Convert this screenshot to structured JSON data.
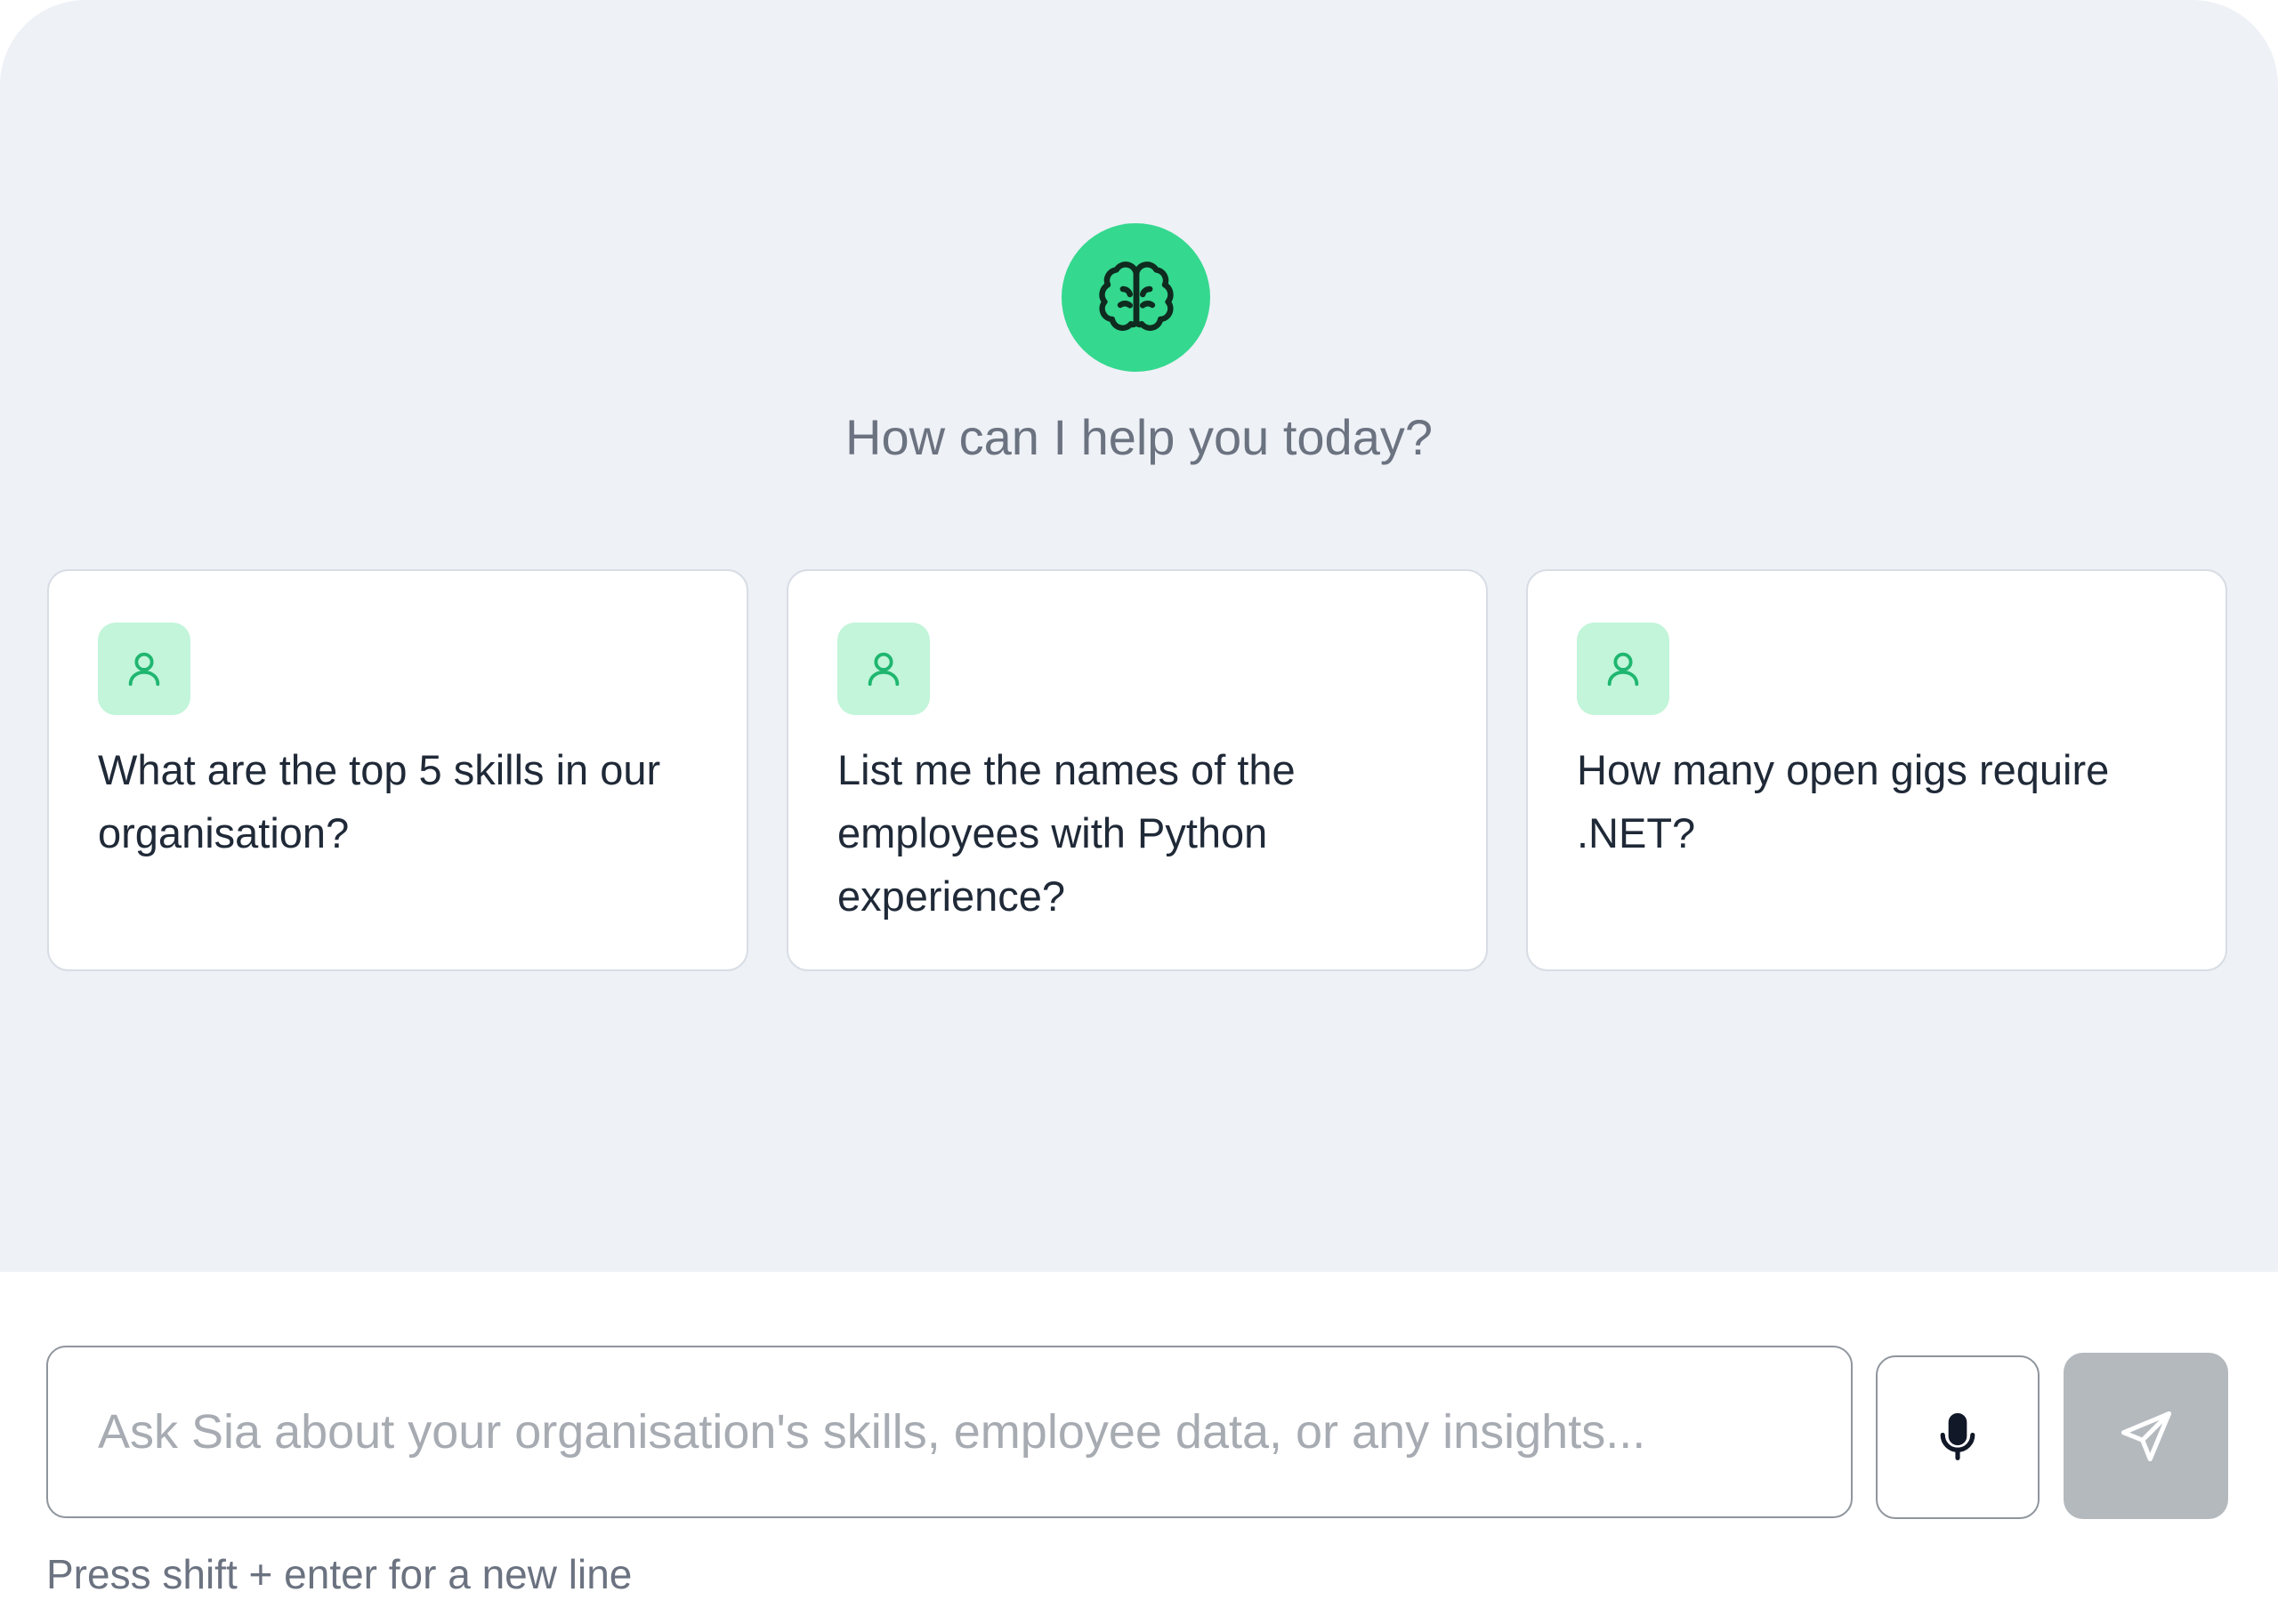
{
  "assistant": {
    "greeting": "How can I help you today?",
    "logo_icon": "brain-icon",
    "accent_color": "#34d88f"
  },
  "suggestions": [
    {
      "icon": "user-icon",
      "text": "What are the top 5 skills in our organisation?"
    },
    {
      "icon": "user-icon",
      "text": "List me the names of the employees with Python experience?"
    },
    {
      "icon": "user-icon",
      "text": "How many open gigs require .NET?"
    }
  ],
  "composer": {
    "placeholder": "Ask Sia about your organisation's skills, employee data, or any insights...",
    "mic_icon": "microphone-icon",
    "send_icon": "send-icon",
    "hint": "Press shift + enter for a new line"
  }
}
